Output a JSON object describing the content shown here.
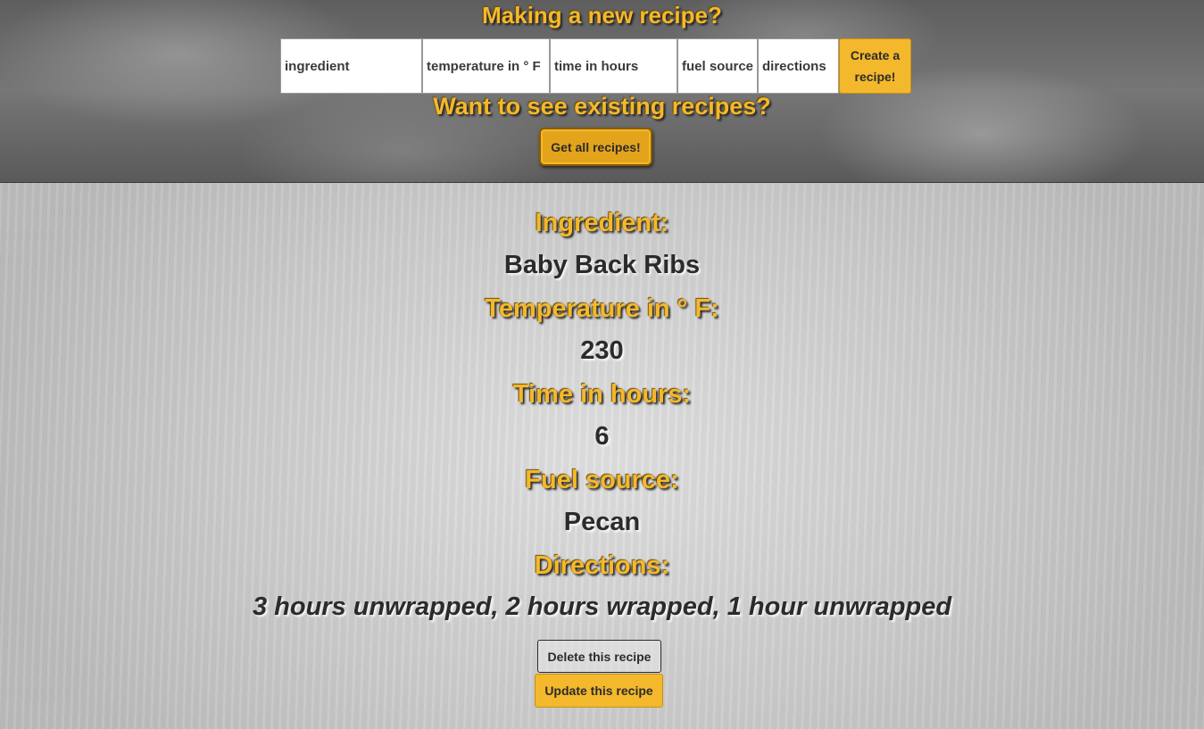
{
  "header": {
    "create_heading": "Making a new recipe?",
    "existing_heading": "Want to see existing recipes?",
    "form": {
      "ingredient_placeholder": "ingredient",
      "temperature_placeholder": "temperature in ° F",
      "time_placeholder": "time in hours",
      "fuel_placeholder": "fuel source",
      "directions_placeholder": "directions",
      "create_button": "Create a recipe!"
    },
    "get_all_button": "Get all recipes!"
  },
  "recipe": {
    "ingredient_label": "Ingredient:",
    "ingredient_value": "Baby Back Ribs",
    "temperature_label": "Temperature in ° F:",
    "temperature_value": "230",
    "time_label": "Time in hours:",
    "time_value": "6",
    "fuel_label": "Fuel source:",
    "fuel_value": "Pecan",
    "directions_label": "Directions:",
    "directions_value": "3 hours unwrapped, 2 hours wrapped, 1 hour unwrapped",
    "delete_button": "Delete this recipe",
    "update_button": "Update this recipe"
  },
  "colors": {
    "accent": "#f4b82c",
    "text_dark": "#2b2b2b"
  }
}
